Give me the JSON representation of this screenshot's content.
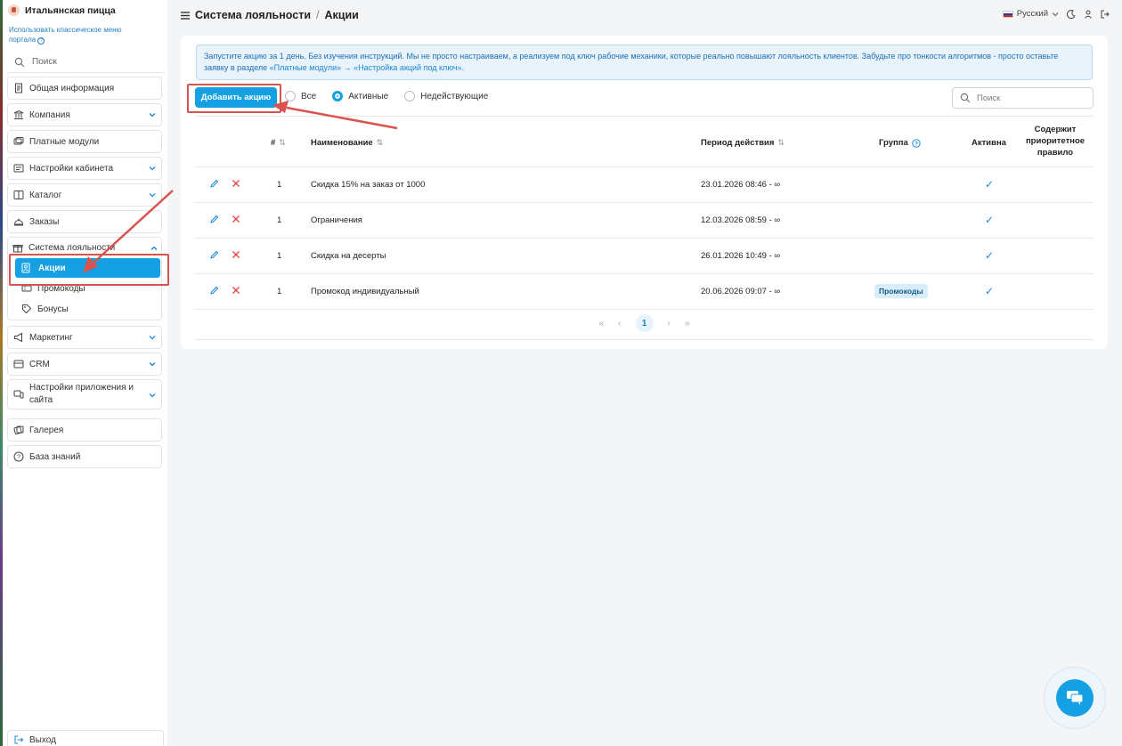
{
  "brand": {
    "name": "Итальянская пицца"
  },
  "sidebar": {
    "classic_menu_link": "Использовать классическое меню портала",
    "search_placeholder": "Поиск",
    "items": [
      {
        "label": "Общая информация"
      },
      {
        "label": "Компания"
      },
      {
        "label": "Платные модули"
      },
      {
        "label": "Настройки кабинета"
      },
      {
        "label": "Каталог"
      },
      {
        "label": "Заказы"
      },
      {
        "label": "Система лояльности"
      },
      {
        "label": "Маркетинг"
      },
      {
        "label": "CRM"
      },
      {
        "label": "Настройки приложения и сайта"
      },
      {
        "label": "Галерея"
      },
      {
        "label": "База знаний"
      }
    ],
    "loyalty_sub": [
      {
        "label": "Акции"
      },
      {
        "label": "Промокоды"
      },
      {
        "label": "Бонусы"
      }
    ],
    "logout_label": "Выход"
  },
  "header": {
    "section": "Система лояльности",
    "separator": "/",
    "page": "Акции",
    "language": "Русский"
  },
  "notice": {
    "text": "Запустите акцию за 1 день. Без изучения инструкций. Мы не просто настраиваем, а реализуем под ключ рабочие механики, которые реально повышают лояльность клиентов. Забудьте про тонкости алгоритмов - просто оставьте заявку в разделе ",
    "link1": "«Платные модули»",
    "arrow": " → ",
    "link2": "«Настройка акций под ключ»",
    "end": "."
  },
  "toolbar": {
    "add_label": "Добавить акцию",
    "filters": [
      "Все",
      "Активные",
      "Недействующие"
    ],
    "selected_filter": "Активные",
    "search_placeholder": "Поиск"
  },
  "table": {
    "headers": {
      "num": "#",
      "name": "Наименование",
      "period": "Период действия",
      "group": "Группа",
      "active": "Активна",
      "priority": [
        "Содержит",
        "приоритетное",
        "правило"
      ]
    },
    "rows": [
      {
        "num": "1",
        "name": "Скидка 15% на заказ от 1000",
        "period": "23.01.2026 08:46 - ∞",
        "group": "",
        "active": "✓"
      },
      {
        "num": "1",
        "name": "Ограничения",
        "period": "12.03.2026 08:59 - ∞",
        "group": "",
        "active": "✓"
      },
      {
        "num": "1",
        "name": "Скидка на десерты",
        "period": "26.01.2026 10:49 - ∞",
        "group": "",
        "active": "✓"
      },
      {
        "num": "1",
        "name": "Промокод индивидуальный",
        "period": "20.06.2026 09:07 - ∞",
        "group": "Промокоды",
        "active": "✓"
      }
    ]
  },
  "pagination": {
    "first": "«",
    "prev": "‹",
    "current": "1",
    "next": "›",
    "last": "»"
  },
  "colors": {
    "accent": "#14a0e2",
    "highlight": "#d9534f",
    "check": "#1a87d6",
    "delete": "#e04040"
  }
}
